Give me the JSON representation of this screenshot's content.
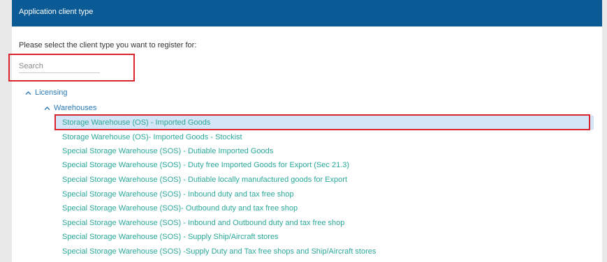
{
  "header": {
    "title": "Application client type"
  },
  "prompt": "Please select the client type you want to register for:",
  "search": {
    "placeholder": "Search"
  },
  "tree": {
    "licensing_label": "Licensing",
    "warehouses_label": "Warehouses",
    "items": [
      {
        "label": "Storage Warehouse (OS) - Imported Goods",
        "selected": true
      },
      {
        "label": "Storage Warehouse (OS)- Imported Goods - Stockist"
      },
      {
        "label": "Special Storage Warehouse (SOS) - Dutiable Imported Goods"
      },
      {
        "label": "Special Storage Warehouse (SOS) - Duty free Imported Goods for Export (Sec 21.3)"
      },
      {
        "label": "Special Storage Warehouse (SOS) - Dutiable locally manufactured goods for Export"
      },
      {
        "label": "Special Storage Warehouse (SOS) - Inbound duty and tax free shop"
      },
      {
        "label": "Special Storage Warehouse (SOS)- Outbound duty and tax free shop"
      },
      {
        "label": "Special Storage Warehouse (SOS) - Inbound and Outbound duty and tax free shop"
      },
      {
        "label": "Special Storage Warehouse (SOS) - Supply Ship/Aircraft stores"
      },
      {
        "label": "Special Storage Warehouse (SOS) -Supply Duty and Tax free shops and Ship/Aircraft stores"
      }
    ]
  },
  "colors": {
    "header": "#0a5a96",
    "link": "#2a7ab8",
    "leaf": "#2ba89a",
    "selected_bg": "#d4e5f7",
    "highlight": "#d9232d"
  }
}
